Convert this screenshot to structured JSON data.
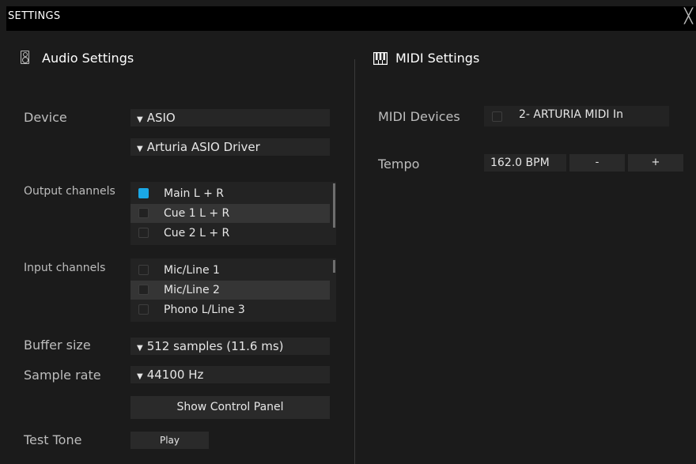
{
  "window": {
    "title": "SETTINGS",
    "close_glyph": "╳"
  },
  "audio": {
    "title": "Audio Settings",
    "icon": "speaker-icon",
    "device_label": "Device",
    "device_type": "ASIO",
    "driver": "Arturia ASIO Driver",
    "output_label": "Output channels",
    "output_channels": [
      {
        "label": "Main L + R",
        "checked": true
      },
      {
        "label": "Cue 1 L + R",
        "checked": false
      },
      {
        "label": "Cue 2 L + R",
        "checked": false
      }
    ],
    "input_label": "Input channels",
    "input_channels": [
      {
        "label": "Mic/Line 1",
        "checked": false
      },
      {
        "label": "Mic/Line 2",
        "checked": false
      },
      {
        "label": "Phono L/Line 3",
        "checked": false
      }
    ],
    "buffer_label": "Buffer size",
    "buffer_value": "512 samples (11.6 ms)",
    "samplerate_label": "Sample rate",
    "samplerate_value": "44100 Hz",
    "control_panel_button": "Show Control Panel",
    "test_tone_label": "Test Tone",
    "play_button": "Play"
  },
  "midi": {
    "title": "MIDI Settings",
    "icon": "piano-keys-icon",
    "devices_label": "MIDI Devices",
    "device_name": "2- ARTURIA MIDI In",
    "device_checked": false,
    "tempo_label": "Tempo",
    "tempo_value": "162.0 BPM",
    "minus_label": "-",
    "plus_label": "+"
  },
  "colors": {
    "accent": "#1aa8e6",
    "background": "#1b1b1b",
    "field": "#262626"
  }
}
